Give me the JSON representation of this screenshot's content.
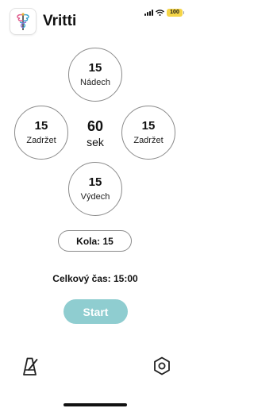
{
  "status_bar": {
    "battery": "100"
  },
  "header": {
    "app_title": "Vritti"
  },
  "phases": {
    "inhale": {
      "value": "15",
      "label": "Nádech"
    },
    "hold_left": {
      "value": "15",
      "label": "Zadržet"
    },
    "hold_right": {
      "value": "15",
      "label": "Zadržet"
    },
    "exhale": {
      "value": "15",
      "label": "Výdech"
    }
  },
  "cycle": {
    "value": "60",
    "unit": "sek"
  },
  "rounds": {
    "label": "Kola: 15"
  },
  "total": {
    "label": "Celkový čas: 15:00"
  },
  "start_button": {
    "label": "Start"
  },
  "bottom_bar": {
    "left_icon": "metronome-icon",
    "right_icon": "settings-icon"
  },
  "colors": {
    "accent": "#8fcdd0",
    "circle_border": "#8a8a8a"
  }
}
